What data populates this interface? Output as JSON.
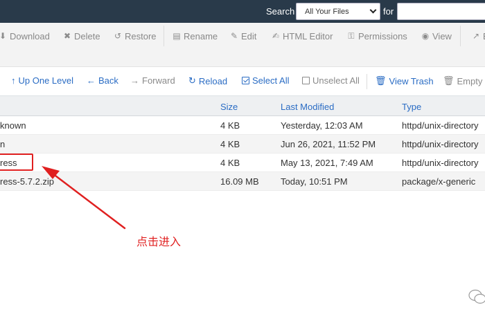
{
  "search": {
    "label": "Search",
    "scope": "All Your Files",
    "for_label": "for",
    "query": ""
  },
  "toolbar": {
    "download": "Download",
    "delete": "Delete",
    "restore": "Restore",
    "rename": "Rename",
    "edit": "Edit",
    "html_editor": "HTML Editor",
    "permissions": "Permissions",
    "view": "View",
    "extract_partial": "E"
  },
  "navbar": {
    "up_one_level": "Up One Level",
    "back": "Back",
    "forward": "Forward",
    "reload": "Reload",
    "select_all": "Select All",
    "unselect_all": "Unselect All",
    "view_trash": "View Trash",
    "empty_trash_partial": "Empty T"
  },
  "table": {
    "headers": {
      "size": "Size",
      "last_modified": "Last Modified",
      "type": "Type"
    },
    "rows": [
      {
        "name": "known",
        "size": "4 KB",
        "modified": "Yesterday, 12:03 AM",
        "type": "httpd/unix-directory"
      },
      {
        "name": "n",
        "size": "4 KB",
        "modified": "Jun 26, 2021, 11:52 PM",
        "type": "httpd/unix-directory"
      },
      {
        "name": "ress",
        "size": "4 KB",
        "modified": "May 13, 2021, 7:49 AM",
        "type": "httpd/unix-directory"
      },
      {
        "name": "ress-5.7.2.zip",
        "size": "16.09 MB",
        "modified": "Today, 10:51 PM",
        "type": "package/x-generic"
      }
    ]
  },
  "annotation": {
    "text": "点击进入",
    "color": "#e02020"
  },
  "colors": {
    "topbar": "#293a4a",
    "link_blue": "#2a6cc4",
    "muted_grey": "#888888"
  }
}
